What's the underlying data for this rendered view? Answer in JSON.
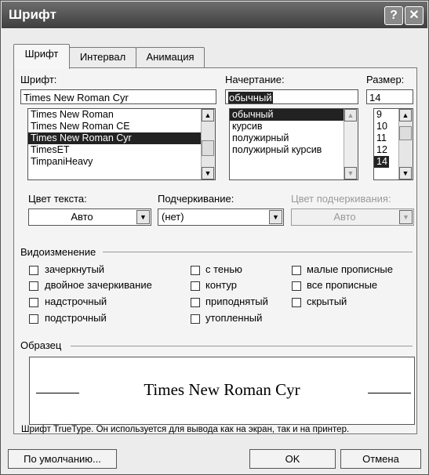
{
  "window": {
    "title": "Шрифт",
    "help_label": "?",
    "close_label": "✕"
  },
  "tabs": [
    {
      "label": "Шрифт",
      "active": true
    },
    {
      "label": "Интервал",
      "active": false
    },
    {
      "label": "Анимация",
      "active": false
    }
  ],
  "font": {
    "label": "Шрифт:",
    "value": "Times New Roman Cyr",
    "options": [
      "Times New Roman",
      "Times New Roman CE",
      "Times New Roman Cyr",
      "TimesET",
      "TimpaniHeavy"
    ],
    "selected_index": 2
  },
  "style": {
    "label": "Начертание:",
    "value": "обычный",
    "options": [
      "обычный",
      "курсив",
      "полужирный",
      "полужирный курсив"
    ],
    "selected_index": 0
  },
  "size": {
    "label": "Размер:",
    "value": "14",
    "options": [
      "9",
      "10",
      "11",
      "12",
      "14"
    ],
    "selected_index": 4
  },
  "color": {
    "label": "Цвет текста:",
    "value": "Авто"
  },
  "underline": {
    "label": "Подчеркивание:",
    "value": "(нет)"
  },
  "underline_color": {
    "label": "Цвет подчеркивания:",
    "value": "Авто",
    "disabled": true
  },
  "effects": {
    "label": "Видоизменение",
    "col1": [
      "зачеркнутый",
      "двойное зачеркивание",
      "надстрочный",
      "подстрочный"
    ],
    "col2": [
      "с тенью",
      "контур",
      "приподнятый",
      "утопленный"
    ],
    "col3": [
      "малые прописные",
      "все прописные",
      "скрытый"
    ]
  },
  "preview": {
    "label": "Образец",
    "text": "Times New Roman Cyr",
    "note": "Шрифт TrueType. Он используется для вывода как на экран, так и на принтер."
  },
  "buttons": {
    "default": "По умолчанию...",
    "ok": "OK",
    "cancel": "Отмена"
  },
  "colors": {
    "title_bar": "#4a4a4a",
    "selection": "#222222",
    "dialog_bg": "#ececec"
  }
}
